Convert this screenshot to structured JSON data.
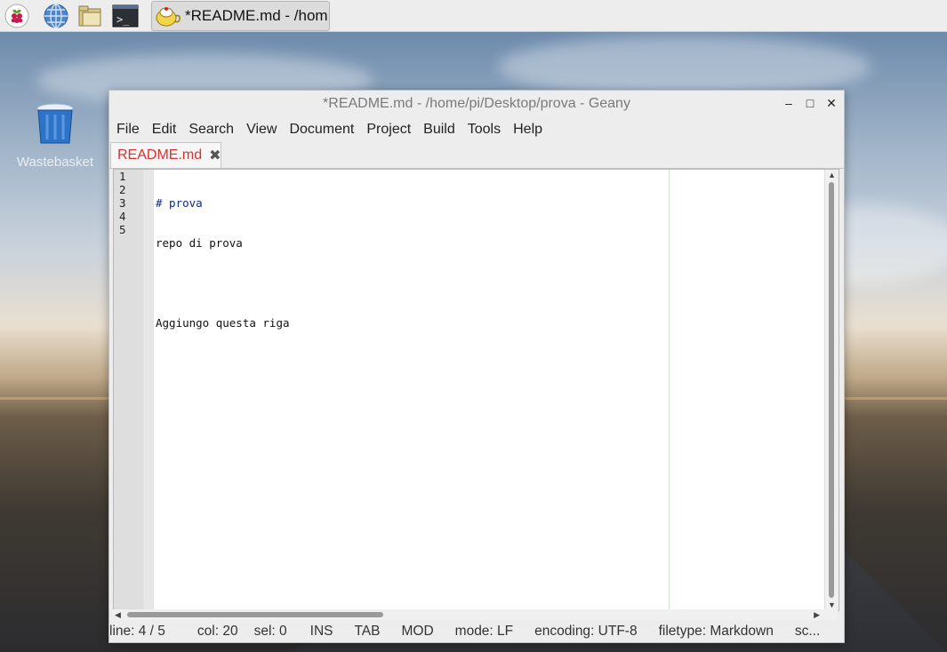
{
  "taskbar": {
    "launchers": [
      {
        "name": "raspberry-menu-icon"
      },
      {
        "name": "web-browser-icon"
      },
      {
        "name": "file-manager-icon"
      },
      {
        "name": "terminal-icon"
      }
    ],
    "active_task": {
      "icon": "geany-icon",
      "label": "*README.md - /hom..."
    }
  },
  "desktop": {
    "icons": [
      {
        "label": "Wastebasket",
        "icon": "trash-icon"
      }
    ]
  },
  "window": {
    "title": "*README.md - /home/pi/Desktop/prova - Geany",
    "controls": {
      "minimize": "–",
      "maximize": "□",
      "close": "✕"
    },
    "menu": [
      "File",
      "Edit",
      "Search",
      "View",
      "Document",
      "Project",
      "Build",
      "Tools",
      "Help"
    ],
    "tabs": [
      {
        "label": "README.md",
        "close": "✖"
      }
    ],
    "editor": {
      "line_numbers": [
        "1",
        "2",
        "3",
        "4",
        "5"
      ],
      "lines": [
        "# prova",
        "repo di prova",
        "",
        "Aggiungo questa riga",
        ""
      ]
    },
    "status": {
      "line": "line: 4 / 5",
      "col": "col: 20",
      "sel": "sel: 0",
      "ins": "INS",
      "tab": "TAB",
      "mod": "MOD",
      "mode": "mode: LF",
      "encoding": "encoding: UTF-8",
      "filetype": "filetype: Markdown",
      "scope": "sc..."
    }
  },
  "colors": {
    "tab_label": "#d63232",
    "wallpaper_sky": "#5f7fa3"
  }
}
